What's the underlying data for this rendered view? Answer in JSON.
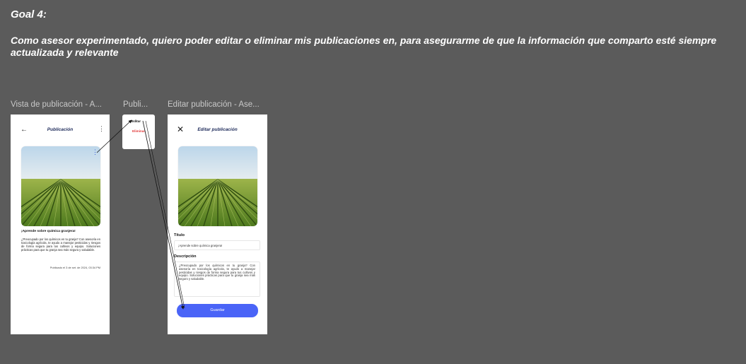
{
  "goal": {
    "title": "Goal 4:",
    "text": "Como asesor experimentado, quiero poder editar o eliminar mis publicaciones en, para asegurarme de que la información que comparto  esté siempre actualizada y relevante"
  },
  "frames": {
    "view_label": "Vista de publicación - A...",
    "menu_label": "Publi...",
    "edit_label": "Editar publicación - Ase..."
  },
  "view_screen": {
    "back_icon": "arrow-left",
    "title": "Publicación",
    "menu_icon": "kebab-vertical",
    "post_title": "¡Aprende sobre química granjera!",
    "post_body": "¿Preocupado por los químicos en tu granja? Con asesoría en toxicología agrícola, te ayudo a manejar pesticidas y riesgos de forma segura para tus cultivos y equipo. Soluciones prácticas para que tu granja sea más segura y saludable.",
    "post_date": "Publicado el 3 de set. de 2024, 03:34 PM"
  },
  "options_menu": {
    "edit": "Editar",
    "delete": "Eliminar",
    "delete_color": "#e23b3b"
  },
  "edit_screen": {
    "close_icon": "close-x",
    "title": "Editar publicación",
    "title_label": "Título",
    "title_value": "¡Aprende sobre química granjera!",
    "description_label": "Descripción",
    "description_value": "¿Preocupado por los químicos en tu granja? Con asesoría en toxicología agrícola, te ayudo a manejar pesticidas y riesgos de forma segura para tus cultivos y equipo. Soluciones prácticas para que tu granja sea más seguro y saludable.",
    "save_button": "Guardar",
    "accent": "#4a64f7"
  }
}
